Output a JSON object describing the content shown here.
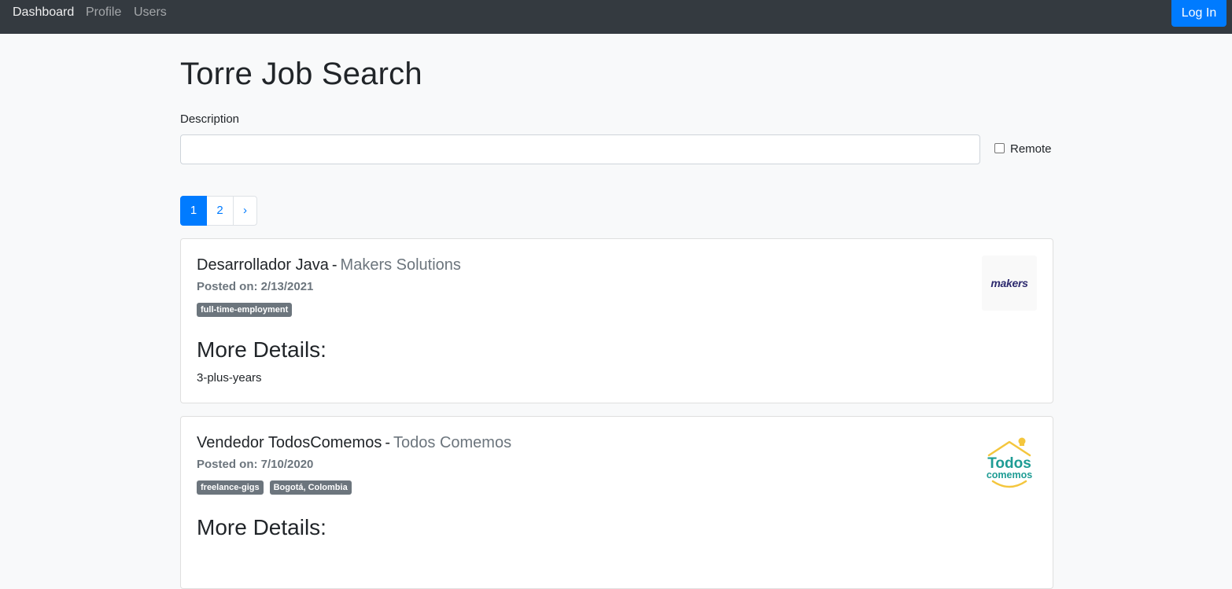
{
  "nav": {
    "items": [
      "Dashboard",
      "Profile",
      "Users"
    ],
    "login_label": "Log In"
  },
  "page": {
    "title": "Torre Job Search",
    "description_label": "Description",
    "description_value": "",
    "remote_label": "Remote",
    "remote_checked": false
  },
  "pagination": {
    "pages": [
      "1",
      "2"
    ],
    "current": "1",
    "next_label": "›"
  },
  "jobs": [
    {
      "title": "Desarrollador Java",
      "separator": "-",
      "company": "Makers Solutions",
      "posted": "Posted on: 2/13/2021",
      "tags": [
        "full-time-employment"
      ],
      "details_heading": "More Details:",
      "details": "3-plus-years",
      "logo_text": "makers"
    },
    {
      "title": "Vendedor TodosComemos",
      "separator": "-",
      "company": "Todos Comemos",
      "posted": "Posted on: 7/10/2020",
      "tags": [
        "freelance-gigs",
        "Bogotá, Colombia"
      ],
      "details_heading": "More Details:",
      "logo_text_1": "Todos",
      "logo_text_2": "comemos"
    }
  ],
  "colors": {
    "navbar": "#343a40",
    "primary": "#007bff",
    "badge": "#6c757d",
    "todos_teal": "#1e9c94",
    "todos_yellow": "#f4c63d"
  }
}
